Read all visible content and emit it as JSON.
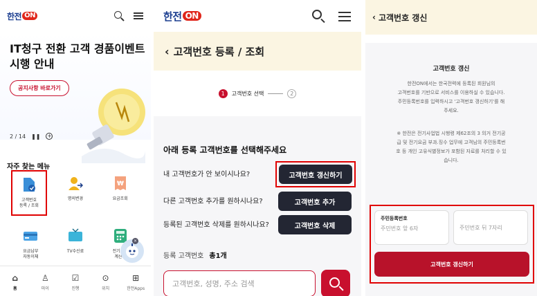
{
  "panel1": {
    "logo": {
      "text": "한전",
      "on": "ON"
    },
    "banner": {
      "title_line1": "IT청구 전환 고객 경품이벤트",
      "title_line2": "시행 안내",
      "notice_button": "공지사항 바로가기",
      "pager": "2 / 14"
    },
    "frequent_menu_title": "자주 찾는 메뉴",
    "menu_items": [
      {
        "label": "고객번호\n등록 / 조회",
        "icon": "document-check-icon",
        "color": "#3a8fd8",
        "highlighted": true
      },
      {
        "label": "명의변경",
        "icon": "person-swap-icon",
        "color": "#f0b21b"
      },
      {
        "label": "요금조회",
        "icon": "bill-won-icon",
        "color": "#e37d58"
      },
      {
        "label": "요금납부\n자동이체",
        "icon": "card-icon",
        "color": "#4aa3e6"
      },
      {
        "label": "TV수신료",
        "icon": "tv-icon",
        "color": "#3bb4d9"
      },
      {
        "label": "전기요금\n계산기",
        "icon": "calculator-icon",
        "color": "#2fae7d"
      }
    ],
    "bottom_nav": [
      {
        "label": "홈",
        "icon": "home-icon",
        "glyph": "⌂",
        "active": true
      },
      {
        "label": "마이",
        "icon": "person-icon",
        "glyph": "♙"
      },
      {
        "label": "진행",
        "icon": "checklist-icon",
        "glyph": "☑"
      },
      {
        "label": "위치",
        "icon": "location-pin-icon",
        "glyph": "⊙"
      },
      {
        "label": "한전Apps",
        "icon": "apps-grid-icon",
        "glyph": "⊞"
      }
    ]
  },
  "panel2": {
    "logo": {
      "text": "한전",
      "on": "ON"
    },
    "page_title": "고객번호 등록 / 조회",
    "step1_num": "1",
    "step1_label": "고객번호 선택",
    "step2_num": "2",
    "prompt": "아래 등록 고객번호를 선택해주세요",
    "rows": [
      {
        "question": "내 고객번호가 안 보이시나요?",
        "button": "고객번호 갱신하기",
        "highlighted": true
      },
      {
        "question": "다른 고객번호 추가를 원하시나요?",
        "button": "고객번호 추가"
      },
      {
        "question": "등록된 고객번호 삭제를 원하시나요?",
        "button": "고객번호 삭제"
      }
    ],
    "registered_label": "등록 고객번호",
    "registered_count": "총1개",
    "search_placeholder": "고객번호, 성명, 주소 검색"
  },
  "panel3": {
    "page_title": "고객번호 갱신",
    "card_title": "고객번호 갱신",
    "desc1_l1": "한전ON에서는 한국전력에 등록된 회원님의",
    "desc1_l2": "고객번호를 기반으로 서비스를 이용하실 수 있습니다.",
    "desc1_l3": "주민등록번호를 입력하시고 '고객번호 갱신하기'를 해",
    "desc1_l4": "주세요.",
    "desc2_l1": "※ 한전은 전기사업법 시행령 제62조의 3 의거 전기공",
    "desc2_l2": "급 및 전기요금 부과.징수 업무에 고객님의 주민등록번",
    "desc2_l3": "호 등 개인 고유식별정보가 포함된 자료를 처리할 수 있",
    "desc2_l4": "습니다.",
    "rrn_label": "주민등록번호",
    "rrn_front_placeholder": "주민번호 앞 6자",
    "rrn_back_placeholder": "주민번호 뒤 7자리",
    "submit_button": "고객번호 갱신하기"
  },
  "colors": {
    "brand_red": "#c8102e",
    "highlight": "#e00000",
    "title_bar": "#fbf5e2",
    "dark_button": "#232633"
  }
}
